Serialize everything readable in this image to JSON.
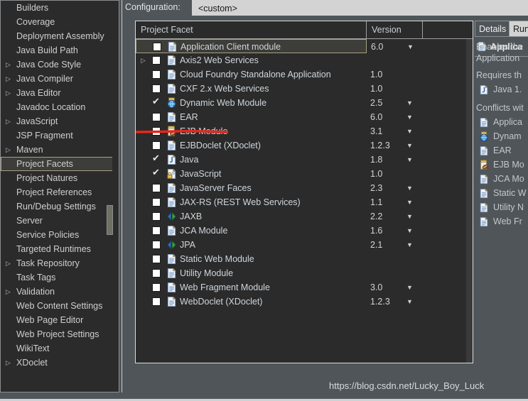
{
  "sidebar": {
    "items": [
      {
        "label": "Builders",
        "expandable": false,
        "selected": false
      },
      {
        "label": "Coverage",
        "expandable": false,
        "selected": false
      },
      {
        "label": "Deployment Assembly",
        "expandable": false,
        "selected": false
      },
      {
        "label": "Java Build Path",
        "expandable": false,
        "selected": false
      },
      {
        "label": "Java Code Style",
        "expandable": true,
        "selected": false
      },
      {
        "label": "Java Compiler",
        "expandable": true,
        "selected": false
      },
      {
        "label": "Java Editor",
        "expandable": true,
        "selected": false
      },
      {
        "label": "Javadoc Location",
        "expandable": false,
        "selected": false
      },
      {
        "label": "JavaScript",
        "expandable": true,
        "selected": false
      },
      {
        "label": "JSP Fragment",
        "expandable": false,
        "selected": false
      },
      {
        "label": "Maven",
        "expandable": true,
        "selected": false
      },
      {
        "label": "Project Facets",
        "expandable": false,
        "selected": true
      },
      {
        "label": "Project Natures",
        "expandable": false,
        "selected": false
      },
      {
        "label": "Project References",
        "expandable": false,
        "selected": false
      },
      {
        "label": "Run/Debug Settings",
        "expandable": false,
        "selected": false
      },
      {
        "label": "Server",
        "expandable": false,
        "selected": false
      },
      {
        "label": "Service Policies",
        "expandable": false,
        "selected": false
      },
      {
        "label": "Targeted Runtimes",
        "expandable": false,
        "selected": false
      },
      {
        "label": "Task Repository",
        "expandable": true,
        "selected": false
      },
      {
        "label": "Task Tags",
        "expandable": false,
        "selected": false
      },
      {
        "label": "Validation",
        "expandable": true,
        "selected": false
      },
      {
        "label": "Web Content Settings",
        "expandable": false,
        "selected": false
      },
      {
        "label": "Web Page Editor",
        "expandable": false,
        "selected": false
      },
      {
        "label": "Web Project Settings",
        "expandable": false,
        "selected": false
      },
      {
        "label": "WikiText",
        "expandable": false,
        "selected": false
      },
      {
        "label": "XDoclet",
        "expandable": true,
        "selected": false
      }
    ]
  },
  "configuration": {
    "label": "Configuration:",
    "value": "<custom>"
  },
  "table": {
    "columns": [
      "Project Facet",
      "Version",
      ""
    ],
    "rows": [
      {
        "name": "Application Client module",
        "version": "6.0",
        "checked": false,
        "expandable": false,
        "caret": true,
        "icon": "document-icon",
        "selected": true
      },
      {
        "name": "Axis2 Web Services",
        "version": "",
        "checked": false,
        "expandable": true,
        "caret": false,
        "icon": "document-icon",
        "selected": false
      },
      {
        "name": "Cloud Foundry Standalone Application",
        "version": "1.0",
        "checked": false,
        "expandable": false,
        "caret": false,
        "icon": "document-icon",
        "selected": false
      },
      {
        "name": "CXF 2.x Web Services",
        "version": "1.0",
        "checked": false,
        "expandable": false,
        "caret": false,
        "icon": "document-icon",
        "selected": false
      },
      {
        "name": "Dynamic Web Module",
        "version": "2.5",
        "checked": true,
        "expandable": false,
        "caret": true,
        "icon": "globe-jar-icon",
        "selected": false
      },
      {
        "name": "EAR",
        "version": "6.0",
        "checked": false,
        "expandable": false,
        "caret": true,
        "icon": "document-icon",
        "selected": false
      },
      {
        "name": "EJB Module",
        "version": "3.1",
        "checked": false,
        "expandable": false,
        "caret": true,
        "icon": "ejb-bean-icon",
        "selected": false
      },
      {
        "name": "EJBDoclet (XDoclet)",
        "version": "1.2.3",
        "checked": false,
        "expandable": false,
        "caret": true,
        "icon": "document-icon",
        "selected": false
      },
      {
        "name": "Java",
        "version": "1.8",
        "checked": true,
        "expandable": false,
        "caret": true,
        "icon": "java-icon",
        "selected": false
      },
      {
        "name": "JavaScript",
        "version": "1.0",
        "checked": true,
        "expandable": false,
        "caret": false,
        "icon": "javascript-lock-icon",
        "selected": false
      },
      {
        "name": "JavaServer Faces",
        "version": "2.3",
        "checked": false,
        "expandable": false,
        "caret": true,
        "icon": "document-icon",
        "selected": false
      },
      {
        "name": "JAX-RS (REST Web Services)",
        "version": "1.1",
        "checked": false,
        "expandable": false,
        "caret": true,
        "icon": "document-icon",
        "selected": false
      },
      {
        "name": "JAXB",
        "version": "2.2",
        "checked": false,
        "expandable": false,
        "caret": true,
        "icon": "arrows-icon",
        "selected": false
      },
      {
        "name": "JCA Module",
        "version": "1.6",
        "checked": false,
        "expandable": false,
        "caret": true,
        "icon": "document-icon",
        "selected": false
      },
      {
        "name": "JPA",
        "version": "2.1",
        "checked": false,
        "expandable": false,
        "caret": true,
        "icon": "arrows-icon",
        "selected": false
      },
      {
        "name": "Static Web Module",
        "version": "",
        "checked": false,
        "expandable": false,
        "caret": false,
        "icon": "document-icon",
        "selected": false
      },
      {
        "name": "Utility Module",
        "version": "",
        "checked": false,
        "expandable": false,
        "caret": false,
        "icon": "document-icon",
        "selected": false
      },
      {
        "name": "Web Fragment Module",
        "version": "3.0",
        "checked": false,
        "expandable": false,
        "caret": true,
        "icon": "document-icon",
        "selected": false
      },
      {
        "name": "WebDoclet (XDoclet)",
        "version": "1.2.3",
        "checked": false,
        "expandable": false,
        "caret": true,
        "icon": "document-icon",
        "selected": false
      }
    ]
  },
  "details_panel": {
    "tabs": [
      {
        "label": "Details",
        "active": true
      },
      {
        "label": "Run",
        "active": false
      }
    ],
    "title": "Applica",
    "title_icon": "document-icon",
    "description_lines": [
      "Enables the",
      "Application"
    ],
    "requires_label": "Requires th",
    "requires_items": [
      {
        "label": "Java 1.",
        "icon": "java-icon"
      }
    ],
    "conflicts_label": "Conflicts wit",
    "conflicts_items": [
      {
        "label": "Applica",
        "icon": "document-icon"
      },
      {
        "label": "Dynam",
        "icon": "globe-jar-icon"
      },
      {
        "label": "EAR",
        "icon": "document-icon"
      },
      {
        "label": "EJB Mo",
        "icon": "ejb-bean-icon"
      },
      {
        "label": "JCA Mo",
        "icon": "document-icon"
      },
      {
        "label": "Static W",
        "icon": "document-icon"
      },
      {
        "label": "Utility N",
        "icon": "document-icon"
      },
      {
        "label": "Web Fr",
        "icon": "document-icon"
      }
    ]
  },
  "watermark": "https://blog.csdn.net/Lucky_Boy_Luck",
  "colors": {
    "window_bg": "#4f5559",
    "panel_bg": "#2b2b2b",
    "selection_bg": "#3d3d39",
    "selection_border": "#a9a086",
    "text": "#cfd6dc",
    "annotation_red": "#e8261c"
  }
}
